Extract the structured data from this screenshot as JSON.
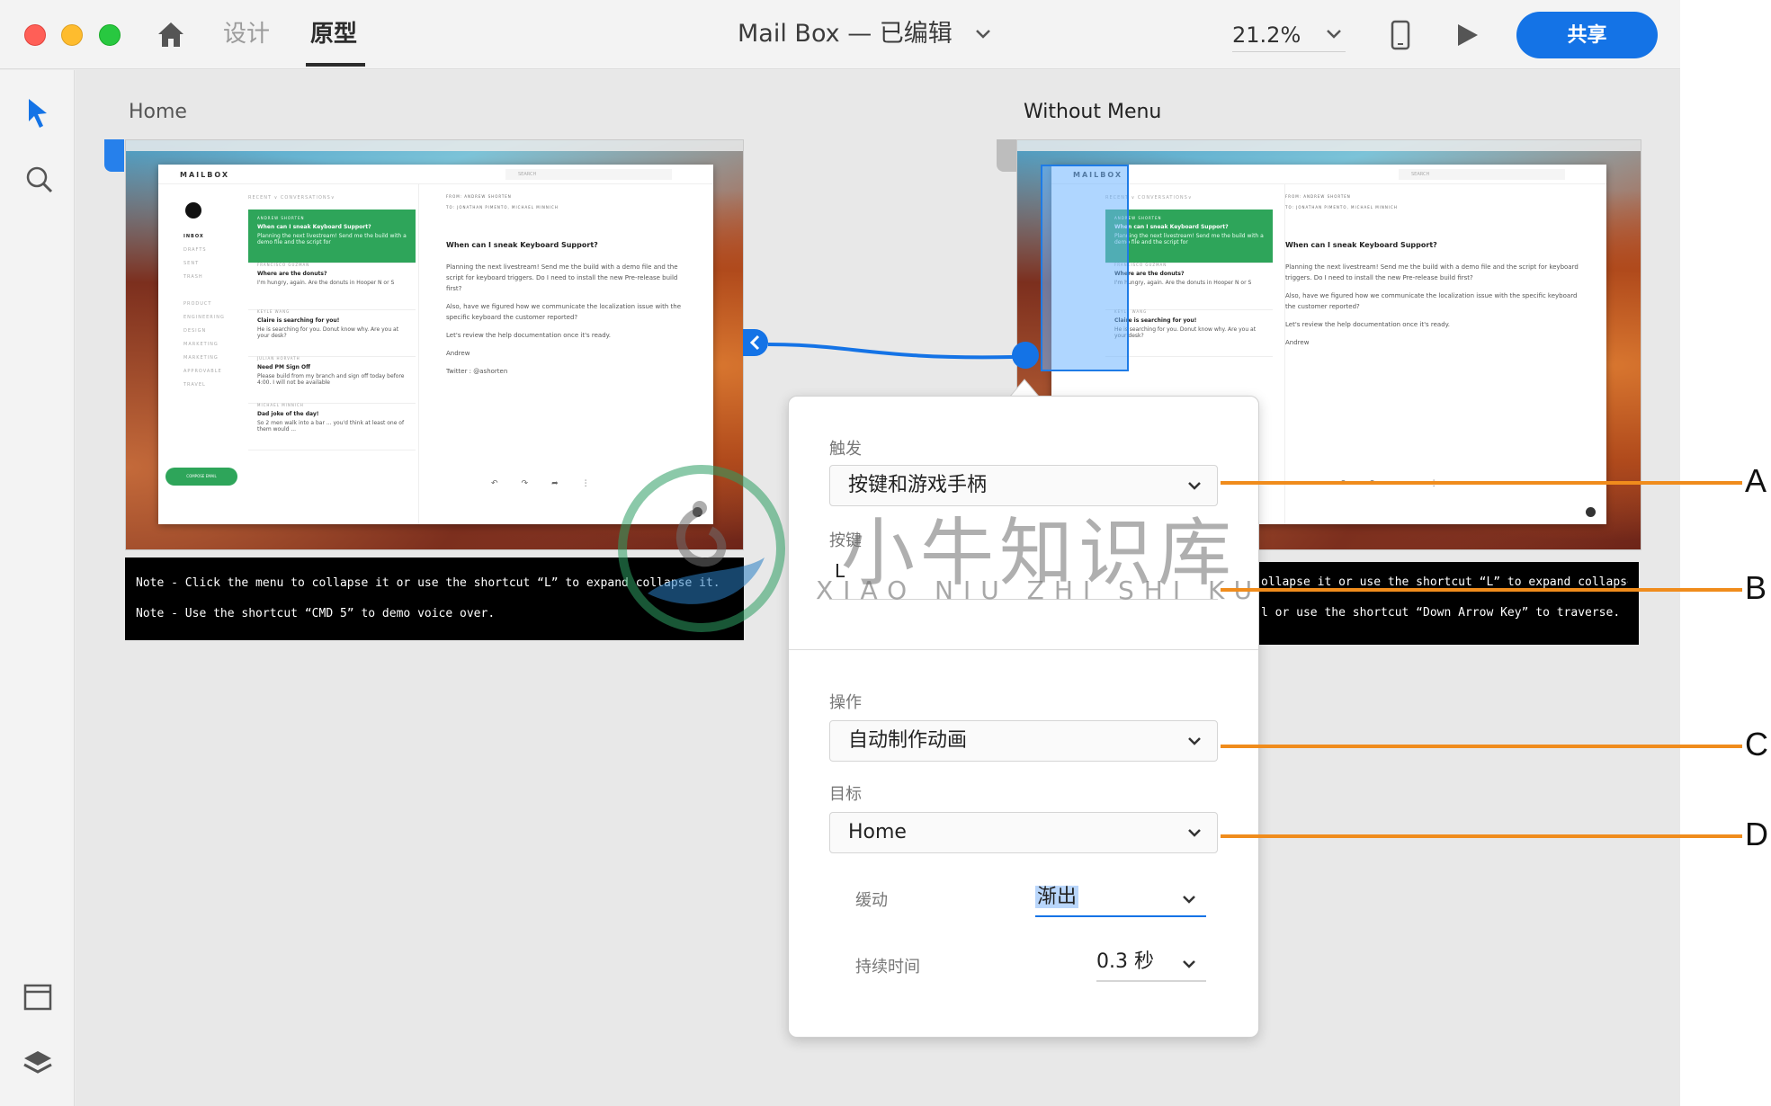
{
  "window": {
    "mode_tabs": {
      "design": "设计",
      "prototype": "原型"
    },
    "document_title": "Mail Box — 已编辑",
    "zoom": "21.2%",
    "share_label": "共享"
  },
  "canvas": {
    "artboards": [
      {
        "label": "Home"
      },
      {
        "label": "Without Menu"
      }
    ],
    "mailbox": {
      "logo": "MAILBOX",
      "search_placeholder": "SEARCH",
      "list_header": "RECENT ∨     CONVERSATIONS∨",
      "nav": [
        "INBOX",
        "DRAFTS",
        "SENT",
        "TRASH",
        "PRODUCT",
        "ENGINEERING",
        "DESIGN",
        "MARKETING",
        "MARKETING",
        "APPROVABLE",
        "TRAVEL"
      ],
      "compose_label": "COMPOSE EMAIL",
      "messages": [
        {
          "from": "ANDREW SHORTEN",
          "subject": "When can I sneak Keyboard Support?",
          "preview": "Planning the next livestream! Send me the build with a demo file and the script for"
        },
        {
          "from": "FRANCISCO GUZMAN",
          "subject": "Where are the donuts?",
          "preview": "I'm hungry, again. Are the donuts in Hooper N or S"
        },
        {
          "from": "KEYLE WANG",
          "subject": "Claire is searching for you!",
          "preview": "He is searching for you. Donut know why. Are you at your desk?"
        },
        {
          "from": "JULIAN HORVATH",
          "subject": "Need PM Sign Off",
          "preview": "Please build from my branch and sign off today before 4:00. I will not be available"
        },
        {
          "from": "MICHAEL MINNICH",
          "subject": "Dad joke of the day!",
          "preview": "So 2 men walk into a bar ... you'd think at least one of them would ..."
        }
      ],
      "reader": {
        "from_line": "FROM: ANDREW SHORTEN",
        "to_line": "TO: JONATHAN PIMENTO, MICHAEL MINNICH",
        "subject": "When can I sneak Keyboard Support?",
        "body_1": "Planning the next livestream! Send me the build with a demo file and the script for keyboard triggers. Do I need to install the new Pre-release build first?",
        "body_2": "Also, have we figured how we communicate the localization issue with the specific keyboard the customer reported?",
        "body_3": "Let's review the help documentation once it's ready.",
        "signature": "Andrew",
        "twitter": "Twitter : @ashorten"
      }
    },
    "notes": {
      "home": [
        "Note - Click the menu to collapse it or use the shortcut “L” to expand collapse it.",
        "Note - Use the shortcut “CMD 5” to demo voice over."
      ],
      "without": [
        "ollapse it or use the shortcut “L” to expand collapse it.",
        "l or use the shortcut “Down Arrow Key” to traverse."
      ]
    }
  },
  "panel": {
    "trigger_label": "触发",
    "trigger_value": "按键和游戏手柄",
    "key_label": "按键",
    "key_value": "L",
    "action_label": "操作",
    "action_value": "自动制作动画",
    "target_label": "目标",
    "target_value": "Home",
    "easing_label": "缓动",
    "easing_value": "渐出",
    "duration_label": "持续时间",
    "duration_value": "0.3 秒"
  },
  "watermark": {
    "text": "小牛知识库",
    "subtext": "XIAO NIU ZHI SHI KU"
  },
  "callouts": [
    "A",
    "B",
    "C",
    "D"
  ],
  "colors": {
    "accent": "#1473e6",
    "callout": "#f08c1c",
    "mail_green": "#2ea55a"
  }
}
